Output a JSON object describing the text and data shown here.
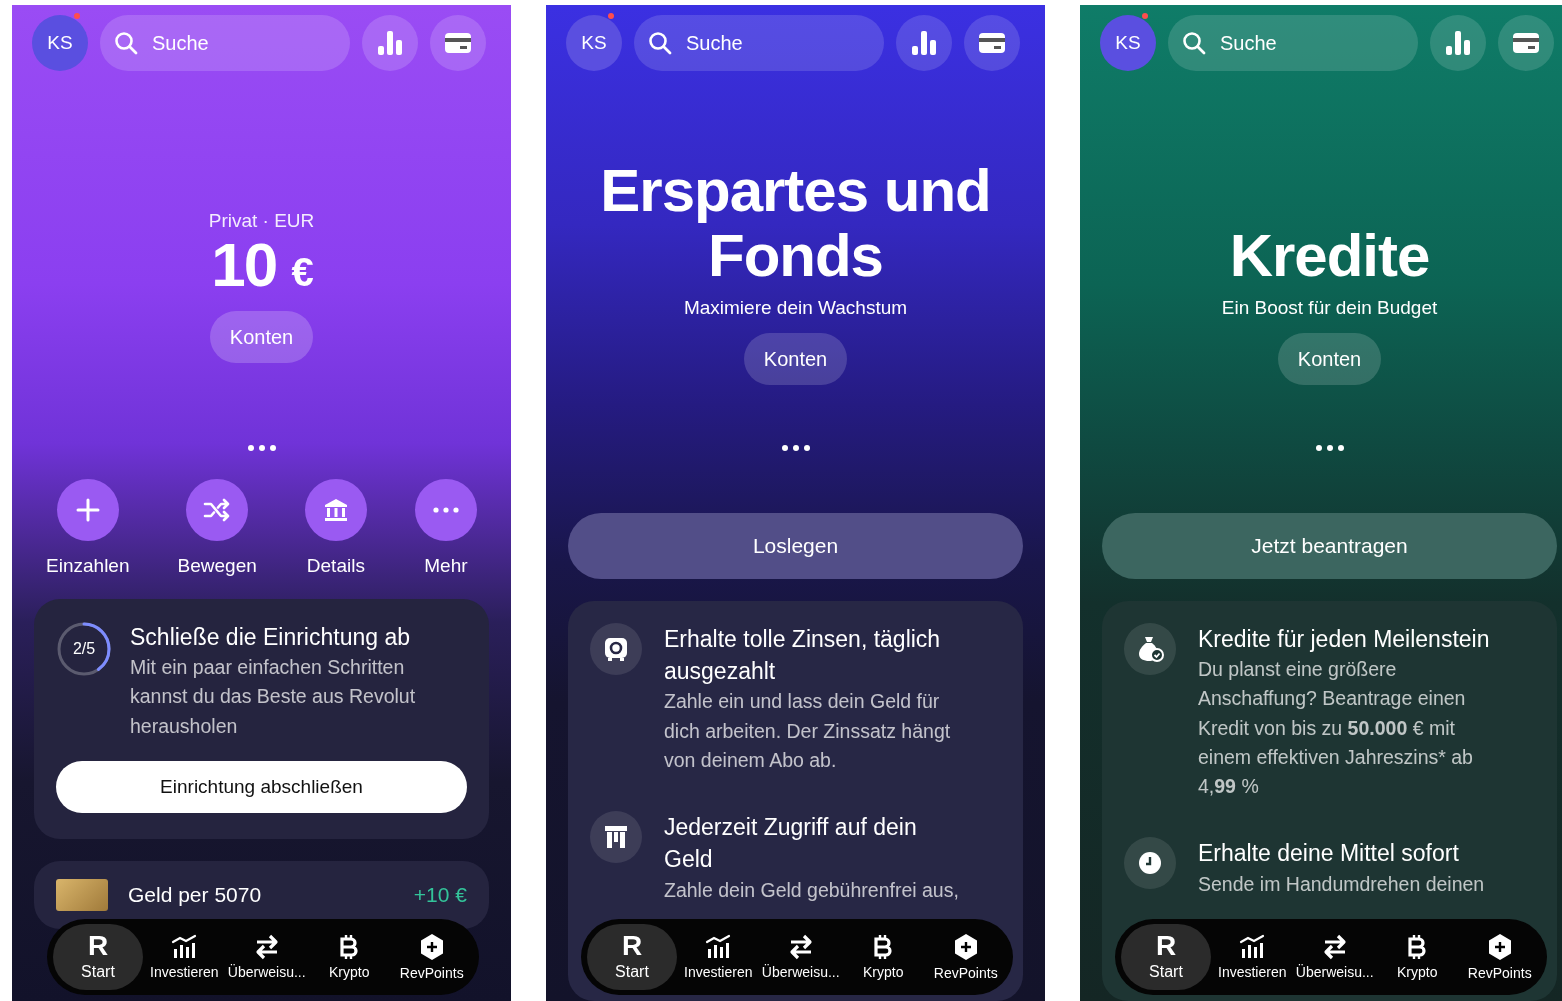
{
  "screens": [
    {
      "avatar": {
        "initials": "KS",
        "notification": true
      },
      "search": {
        "placeholder": "Suche"
      },
      "hero": {
        "kind": "balance",
        "label": "Privat · EUR",
        "amount": "10",
        "currency": "€"
      },
      "accounts_button": "Konten",
      "actions": [
        {
          "label": "Einzahlen"
        },
        {
          "label": "Bewegen"
        },
        {
          "label": "Details"
        },
        {
          "label": "Mehr"
        }
      ],
      "setup_card": {
        "progress": {
          "label": "2/5",
          "level": 0.4
        },
        "title": "Schließe die Einrichtung ab",
        "text": "Mit ein paar einfachen Schritten kannst du das Beste aus Revolut herausholen",
        "button": "Einrichtung abschließen"
      },
      "transaction": {
        "title": "Geld per 5070",
        "amount": "+10 €"
      },
      "nav": [
        {
          "glyph": "R",
          "label": "Start",
          "selected": true
        },
        {
          "label": "Investieren",
          "selected": false
        },
        {
          "label": "Überweisu...",
          "selected": false
        },
        {
          "label": "Krypto",
          "selected": false
        },
        {
          "label": "RevPoints",
          "selected": false
        }
      ]
    },
    {
      "avatar": {
        "initials": "KS",
        "notification": true
      },
      "search": {
        "placeholder": "Suche"
      },
      "hero": {
        "kind": "headline",
        "title": "Erspartes und Fonds",
        "subtitle": "Maximiere dein Wachstum"
      },
      "accounts_button": "Konten",
      "primary_button": "Loslegen",
      "features": [
        {
          "title": "Erhalte tolle Zinsen, täglich ausgezahlt",
          "text": "Zahle ein und lass dein Geld für dich arbeiten. Der Zinssatz hängt von deinem Abo ab."
        },
        {
          "title": "Jederzeit Zugriff auf dein Geld",
          "text": "Zahle dein Geld gebührenfrei aus,"
        }
      ],
      "nav": [
        {
          "glyph": "R",
          "label": "Start",
          "selected": true
        },
        {
          "label": "Investieren",
          "selected": false
        },
        {
          "label": "Überweisu...",
          "selected": false
        },
        {
          "label": "Krypto",
          "selected": false
        },
        {
          "label": "RevPoints",
          "selected": false
        }
      ]
    },
    {
      "avatar": {
        "initials": "KS",
        "notification": true
      },
      "search": {
        "placeholder": "Suche"
      },
      "hero": {
        "kind": "headline",
        "title": "Kredite",
        "subtitle": "Ein Boost für dein Budget"
      },
      "accounts_button": "Konten",
      "primary_button": "Jetzt beantragen",
      "features": [
        {
          "title": "Kredite für jeden Meilenstein",
          "text": "Du planst eine größere Anschaffung? Beantrage einen Kredit von bis zu **50.000** € mit einem effektiven Jahreszins* ab 4,**99** %"
        },
        {
          "title": "Erhalte deine Mittel sofort",
          "text": "Sende im Handumdrehen deinen"
        }
      ],
      "nav": [
        {
          "glyph": "R",
          "label": "Start",
          "selected": true
        },
        {
          "label": "Investieren",
          "selected": false
        },
        {
          "label": "Überweisu...",
          "selected": false
        },
        {
          "label": "Krypto",
          "selected": false
        },
        {
          "label": "RevPoints",
          "selected": false
        }
      ]
    }
  ]
}
